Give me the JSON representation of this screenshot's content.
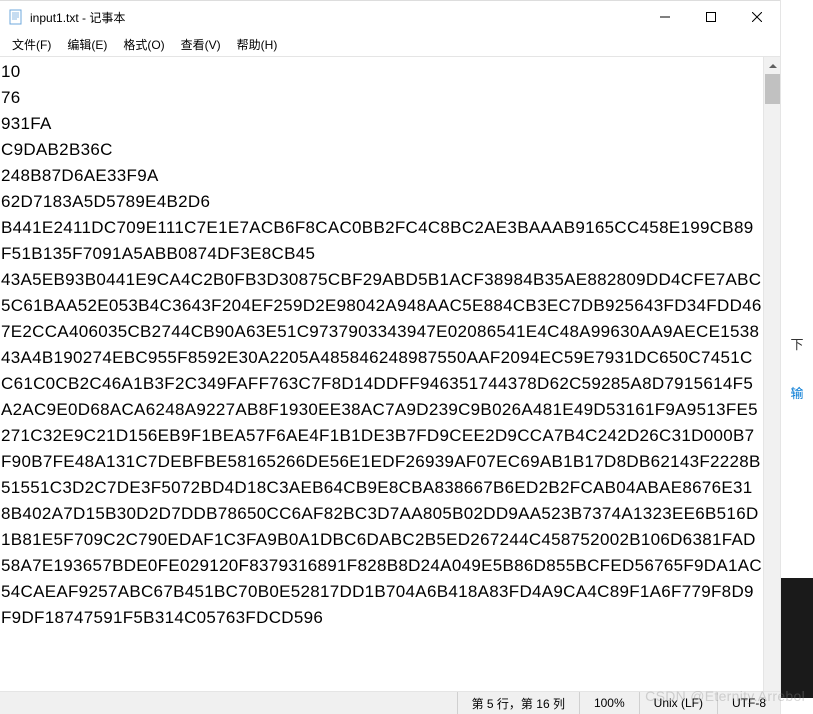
{
  "titlebar": {
    "title": "input1.txt - 记事本"
  },
  "menu": {
    "file": "文件(F)",
    "edit": "编辑(E)",
    "format": "格式(O)",
    "view": "查看(V)",
    "help": "帮助(H)"
  },
  "content": "10\n76\n931FA\nC9DAB2B36C\n248B87D6AE33F9A\n62D7183A5D5789E4B2D6\nB441E2411DC709E111C7E1E7ACB6F8CAC0BB2FC4C8BC2AE3BAAAB9165CC458E199CB89F51B135F7091A5ABB0874DF3E8CB45\n43A5EB93B0441E9CA4C2B0FB3D30875CBF29ABD5B1ACF38984B35AE882809DD4CFE7ABC5C61BAA52E053B4C3643F204EF259D2E98042A948AAC5E884CB3EC7DB925643FD34FDD467E2CCA406035CB2744CB90A63E51C9737903343947E02086541E4C48A99630AA9AECE153843A4B190274EBC955F8592E30A2205A485846248987550AAF2094EC59E7931DC650C7451CC61C0CB2C46A1B3F2C349FAFF763C7F8D14DDFF946351744378D62C59285A8D7915614F5A2AC9E0D68ACA6248A9227AB8F1930EE38AC7A9D239C9B026A481E49D53161F9A9513FE5271C32E9C21D156EB9F1BEA57F6AE4F1B1DE3B7FD9CEE2D9CCA7B4C242D26C31D000B7F90B7FE48A131C7DEBFBE58165266DE56E1EDF26939AF07EC69AB1B17D8DB62143F2228B51551C3D2C7DE3F5072BD4D18C3AEB64CB9E8CBA838667B6ED2B2FCAB04ABAE8676E318B402A7D15B30D2D7DDB78650CC6AF82BC3D7AA805B02DD9AA523B7374A1323EE6B516D1B81E5F709C2C790EDAF1C3FA9B0A1DBC6DABC2B5ED267244C458752002B106D6381FAD58A7E193657BDE0FE029120F8379316891F828B8D24A049E5B86D855BCFED56765F9DA1AC54CAEAF9257ABC67B451BC70B0E52817DD1B704A6B418A83FD4A9CA4C89F1A6F779F8D9F9DF18747591F5B314C05763FDCD596",
  "status": {
    "cursor": "第 5 行，第 16 列",
    "zoom": "100%",
    "line_ending": "Unix (LF)",
    "encoding": "UTF-8"
  },
  "right_panel": {
    "label1": "下",
    "label2": "输"
  },
  "watermark": "CSDN @Eternity.Arrebol"
}
